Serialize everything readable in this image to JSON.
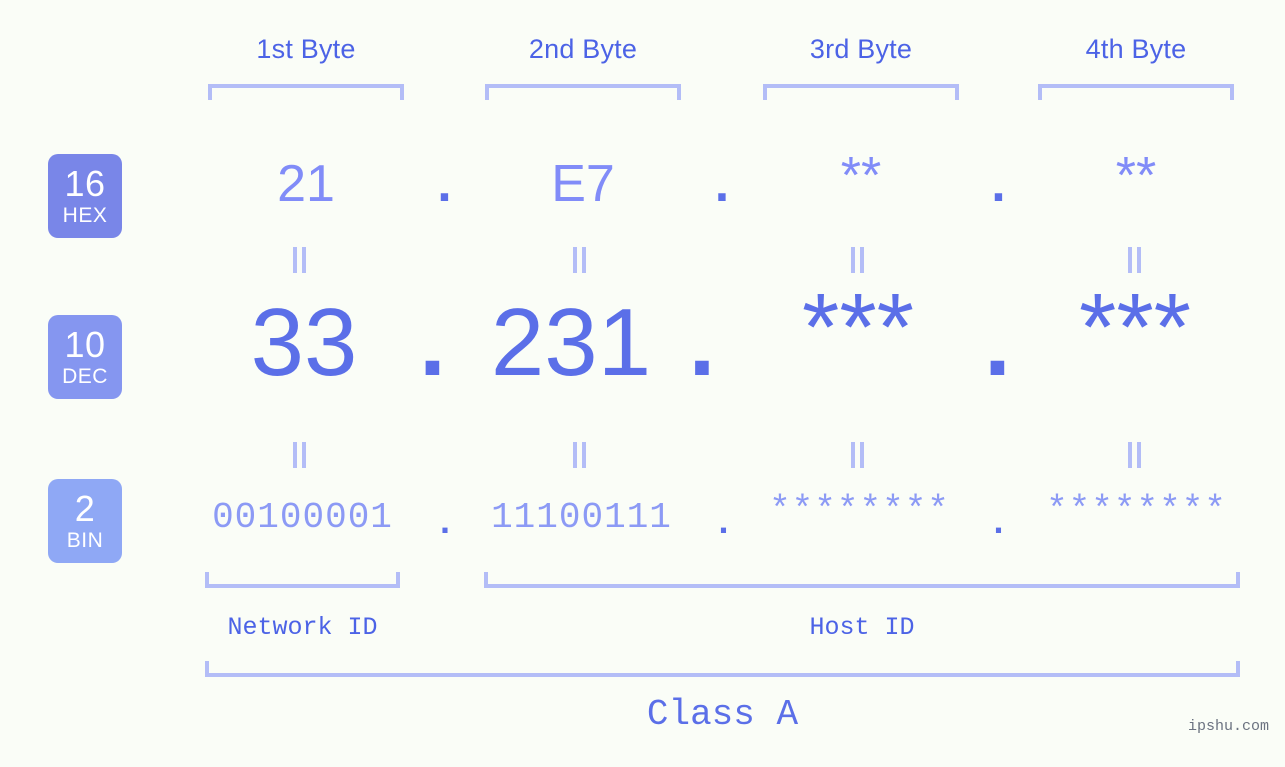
{
  "theme": {
    "background": "#fafdf7",
    "accent_strong": "#4c63e6",
    "accent_mid": "#5b6fe8",
    "accent_light": "#818cf8",
    "accent_pale": "#b3bdf7",
    "badge_hex_bg": "#7986e8",
    "badge_dec_bg": "#8596f0",
    "badge_bin_bg": "#8fa8f5",
    "watermark_color": "#6b7280"
  },
  "header": {
    "byte_labels": [
      {
        "label": "1st Byte"
      },
      {
        "label": "2nd Byte"
      },
      {
        "label": "3rd Byte"
      },
      {
        "label": "4th Byte"
      }
    ]
  },
  "bases": [
    {
      "number": "16",
      "name": "HEX"
    },
    {
      "number": "10",
      "name": "DEC"
    },
    {
      "number": "2",
      "name": "BIN"
    }
  ],
  "rows": {
    "hex": {
      "base_number": "16",
      "base_name": "HEX",
      "values": [
        "21",
        "E7",
        "**",
        "**"
      ],
      "separator": "."
    },
    "dec": {
      "base_number": "10",
      "base_name": "DEC",
      "values": [
        "33",
        "231",
        "***",
        "***"
      ],
      "separator": "."
    },
    "bin": {
      "base_number": "2",
      "base_name": "BIN",
      "values": [
        "00100001",
        "11100111",
        "********",
        "********"
      ],
      "separator": "."
    }
  },
  "equality_marks": {
    "symbol": "=",
    "count_per_row": 4,
    "rows": 2
  },
  "footer": {
    "network_id_label": "Network ID",
    "host_id_label": "Host ID",
    "class_label": "Class A",
    "watermark": "ipshu.com"
  }
}
